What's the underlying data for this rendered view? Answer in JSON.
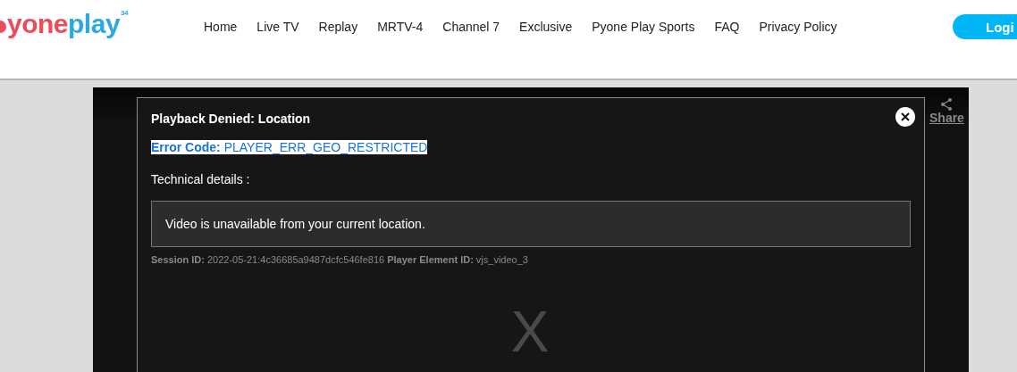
{
  "logo": {
    "red": "yone",
    "blue": "play",
    "badge": "34"
  },
  "nav": [
    {
      "label": "Home"
    },
    {
      "label": "Live TV"
    },
    {
      "label": "Replay"
    },
    {
      "label": "MRTV-4"
    },
    {
      "label": "Channel 7"
    },
    {
      "label": "Exclusive"
    },
    {
      "label": "Pyone Play Sports"
    },
    {
      "label": "FAQ"
    },
    {
      "label": "Privacy Policy"
    }
  ],
  "login_button": "Logi",
  "player": {
    "share": "Share"
  },
  "error_dialog": {
    "title": "Playback Denied: Location",
    "error_code_label": "Error Code:",
    "error_code": "PLAYER_ERR_GEO_RESTRICTED",
    "technical_label": "Technical details :",
    "message": "Video is unavailable from your current location.",
    "session_label": "Session ID:",
    "session_id": "2022-05-21:4c36685a9487dcfc546fe816",
    "element_label": "Player Element ID:",
    "element_id": "vjs_video_3",
    "big_mark": "X"
  }
}
